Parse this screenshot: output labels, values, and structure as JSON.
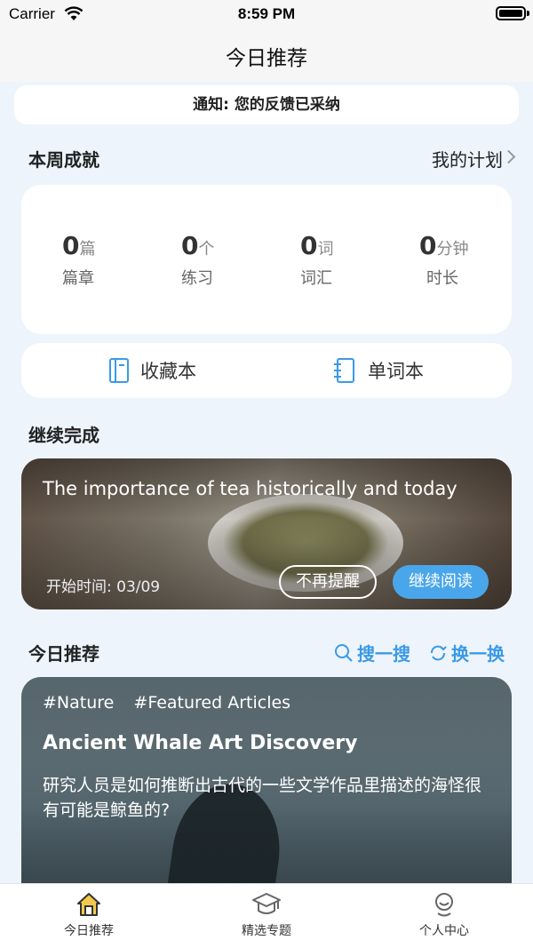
{
  "status_bar": {
    "carrier": "Carrier",
    "time": "8:59 PM"
  },
  "nav": {
    "title": "今日推荐"
  },
  "notice": {
    "text": "通知: 您的反馈已采纳"
  },
  "weekly": {
    "title": "本周成就",
    "plan_link": "我的计划",
    "stats": [
      {
        "value": "0",
        "unit": "篇",
        "label": "篇章"
      },
      {
        "value": "0",
        "unit": "个",
        "label": "练习"
      },
      {
        "value": "0",
        "unit": "词",
        "label": "词汇"
      },
      {
        "value": "0",
        "unit": "分钟",
        "label": "时长"
      }
    ]
  },
  "books": {
    "favorites": "收藏本",
    "vocabulary": "单词本"
  },
  "continue": {
    "title": "继续完成",
    "article_title": "The importance of tea historically and today",
    "start_time": "开始时间: 03/09",
    "dismiss_label": "不再提醒",
    "continue_label": "继续阅读"
  },
  "recommend": {
    "title": "今日推荐",
    "search_label": "搜一搜",
    "refresh_label": "换一换",
    "tags": [
      "#Nature",
      "#Featured Articles"
    ],
    "article_title": "Ancient Whale Art Discovery",
    "description": "研究人员是如何推断出古代的一些文学作品里描述的海怪很有可能是鲸鱼的?"
  },
  "tabs": [
    {
      "label": "今日推荐",
      "icon": "home-icon"
    },
    {
      "label": "精选专题",
      "icon": "graduation-cap-icon"
    },
    {
      "label": "个人中心",
      "icon": "profile-icon"
    }
  ],
  "colors": {
    "accent": "#3a9ae6",
    "button_blue": "#4aa6ea",
    "home_icon": "#f2c94c"
  }
}
